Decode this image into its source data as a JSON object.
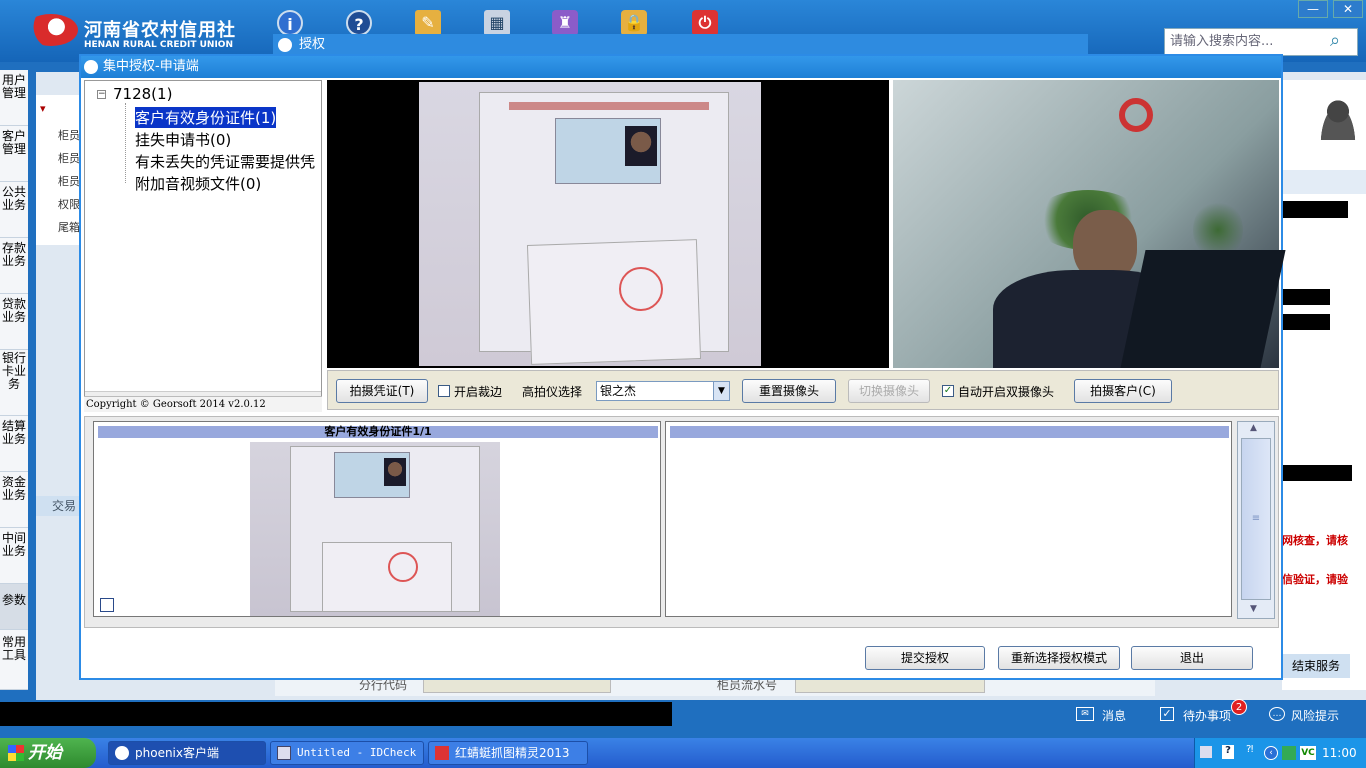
{
  "app": {
    "logo_cn": "河南省农村信用社",
    "logo_en": "HENAN RURAL CREDIT UNION",
    "search_placeholder": "请输入搜索内容...",
    "toolbar_icons": [
      "info-icon",
      "help-icon",
      "tools-icon",
      "calculator-icon",
      "shirt-icon",
      "lock-icon",
      "power-icon"
    ],
    "colors": {
      "accent": "#1f6fbf",
      "dialog_border": "#2c8be6",
      "selection": "#0a35c8",
      "badge": "#e02020"
    }
  },
  "left_nav": {
    "items": [
      "用户管理",
      "客户管理",
      "公共业务",
      "存款业务",
      "贷款业务",
      "银行卡业务",
      "结算业务",
      "资金业务",
      "中间业务",
      "参数",
      "常用工具"
    ]
  },
  "background": {
    "list_rows": [
      "柜员",
      "柜员",
      "柜员",
      "权限",
      "尾箱"
    ],
    "section_label": "交易",
    "auth_tab_title": "授权",
    "red_line1": "网核查，请核",
    "red_line2": "信验证，请验",
    "end_service": "结束服务",
    "bottom_label1": "分行代码",
    "bottom_label2": "柜员流水号"
  },
  "dialog": {
    "title": "集中授权-申请端",
    "tree": {
      "root": "7128(1)",
      "children": [
        "客户有效身份证件(1)",
        "挂失申请书(0)",
        "有未丢失的凭证需要提供凭",
        "附加音视频文件(0)"
      ]
    },
    "copyright": "Copyright © Georsoft 2014 v2.0.12",
    "toolbar": {
      "capture_doc": "拍摄凭证(T)",
      "auto_crop": "开启裁边",
      "auto_crop_checked": false,
      "scanner_label": "高拍仪选择",
      "scanner_value": "银之杰",
      "reset_camera": "重置摄像头",
      "switch_camera": "切换摄像头",
      "auto_dual": "自动开启双摄像头",
      "auto_dual_checked": true,
      "capture_customer": "拍摄客户(C)"
    },
    "thumb_title": "客户有效身份证件1/1",
    "buttons": {
      "submit": "提交授权",
      "reselect": "重新选择授权模式",
      "exit": "退出"
    }
  },
  "status_bar": {
    "messages": "消息",
    "todo": "待办事项",
    "todo_count": "2",
    "risk": "风险提示"
  },
  "taskbar": {
    "start": "开始",
    "tasks": [
      "phoenix客户端",
      "Untitled - IDCheck",
      "红蜻蜓抓图精灵2013"
    ],
    "clock": "11:00"
  }
}
